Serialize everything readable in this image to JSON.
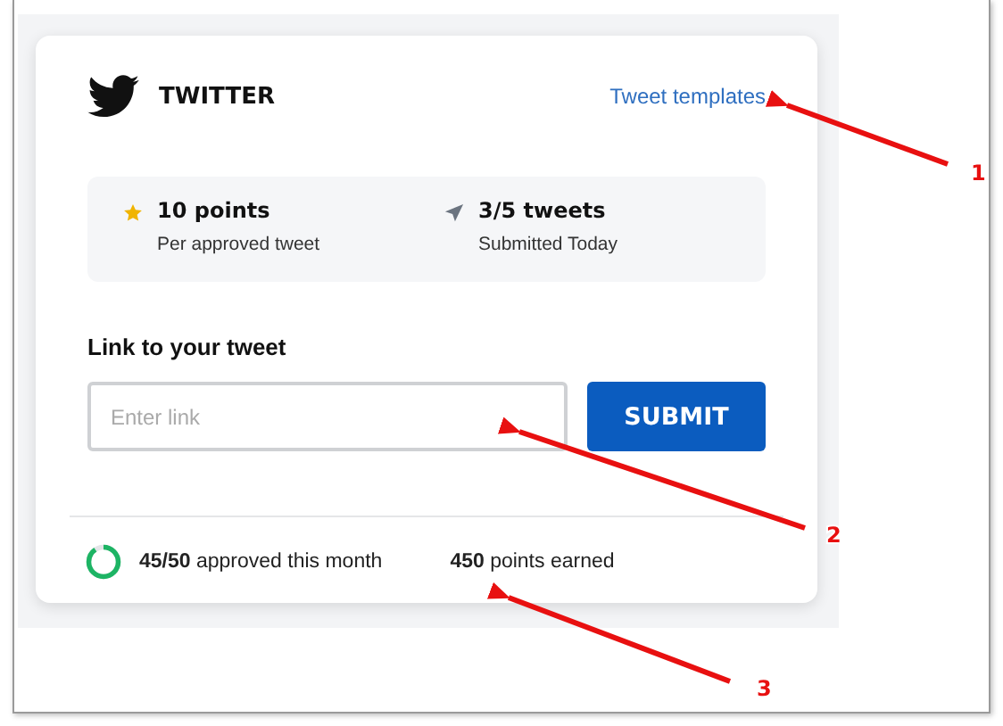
{
  "card": {
    "title": "TWITTER",
    "templates_link": "Tweet templates",
    "stats": [
      {
        "kind": "star",
        "value": "10 points",
        "caption": "Per approved tweet"
      },
      {
        "kind": "send",
        "value": "3/5 tweets",
        "caption": "Submitted Today"
      }
    ],
    "form": {
      "label": "Link to your tweet",
      "placeholder": "Enter link",
      "button": "SUBMIT"
    },
    "footer": {
      "progress": {
        "text": "**45/50** approved this month"
      },
      "points": "**450** points earned"
    }
  },
  "annotations": [
    {
      "label": "1"
    },
    {
      "label": "2"
    },
    {
      "label": "3"
    }
  ]
}
